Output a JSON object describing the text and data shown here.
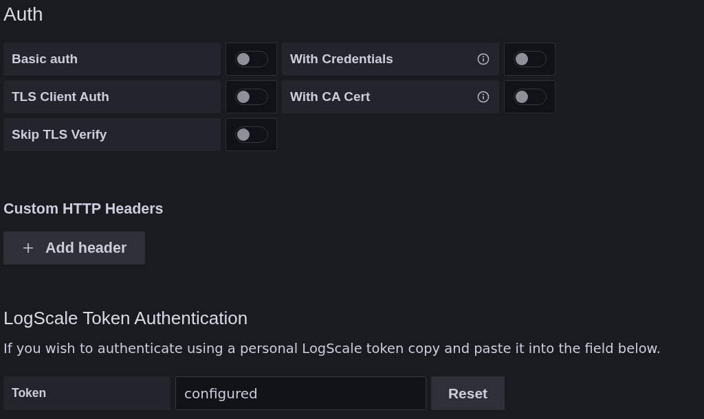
{
  "auth": {
    "title": "Auth",
    "rows": [
      [
        {
          "label": "Basic auth",
          "info": false,
          "on": false
        },
        {
          "label": "With Credentials",
          "info": true,
          "on": false
        }
      ],
      [
        {
          "label": "TLS Client Auth",
          "info": false,
          "on": false
        },
        {
          "label": "With CA Cert",
          "info": true,
          "on": false
        }
      ],
      [
        {
          "label": "Skip TLS Verify",
          "info": false,
          "on": false
        }
      ]
    ]
  },
  "custom_headers": {
    "title": "Custom HTTP Headers",
    "add_button": "Add header"
  },
  "token_auth": {
    "title": "LogScale Token Authentication",
    "description": "If you wish to authenticate using a personal LogScale token copy and paste it into the field below.",
    "field": {
      "label": "Token",
      "value": "configured"
    },
    "reset_button": "Reset"
  }
}
